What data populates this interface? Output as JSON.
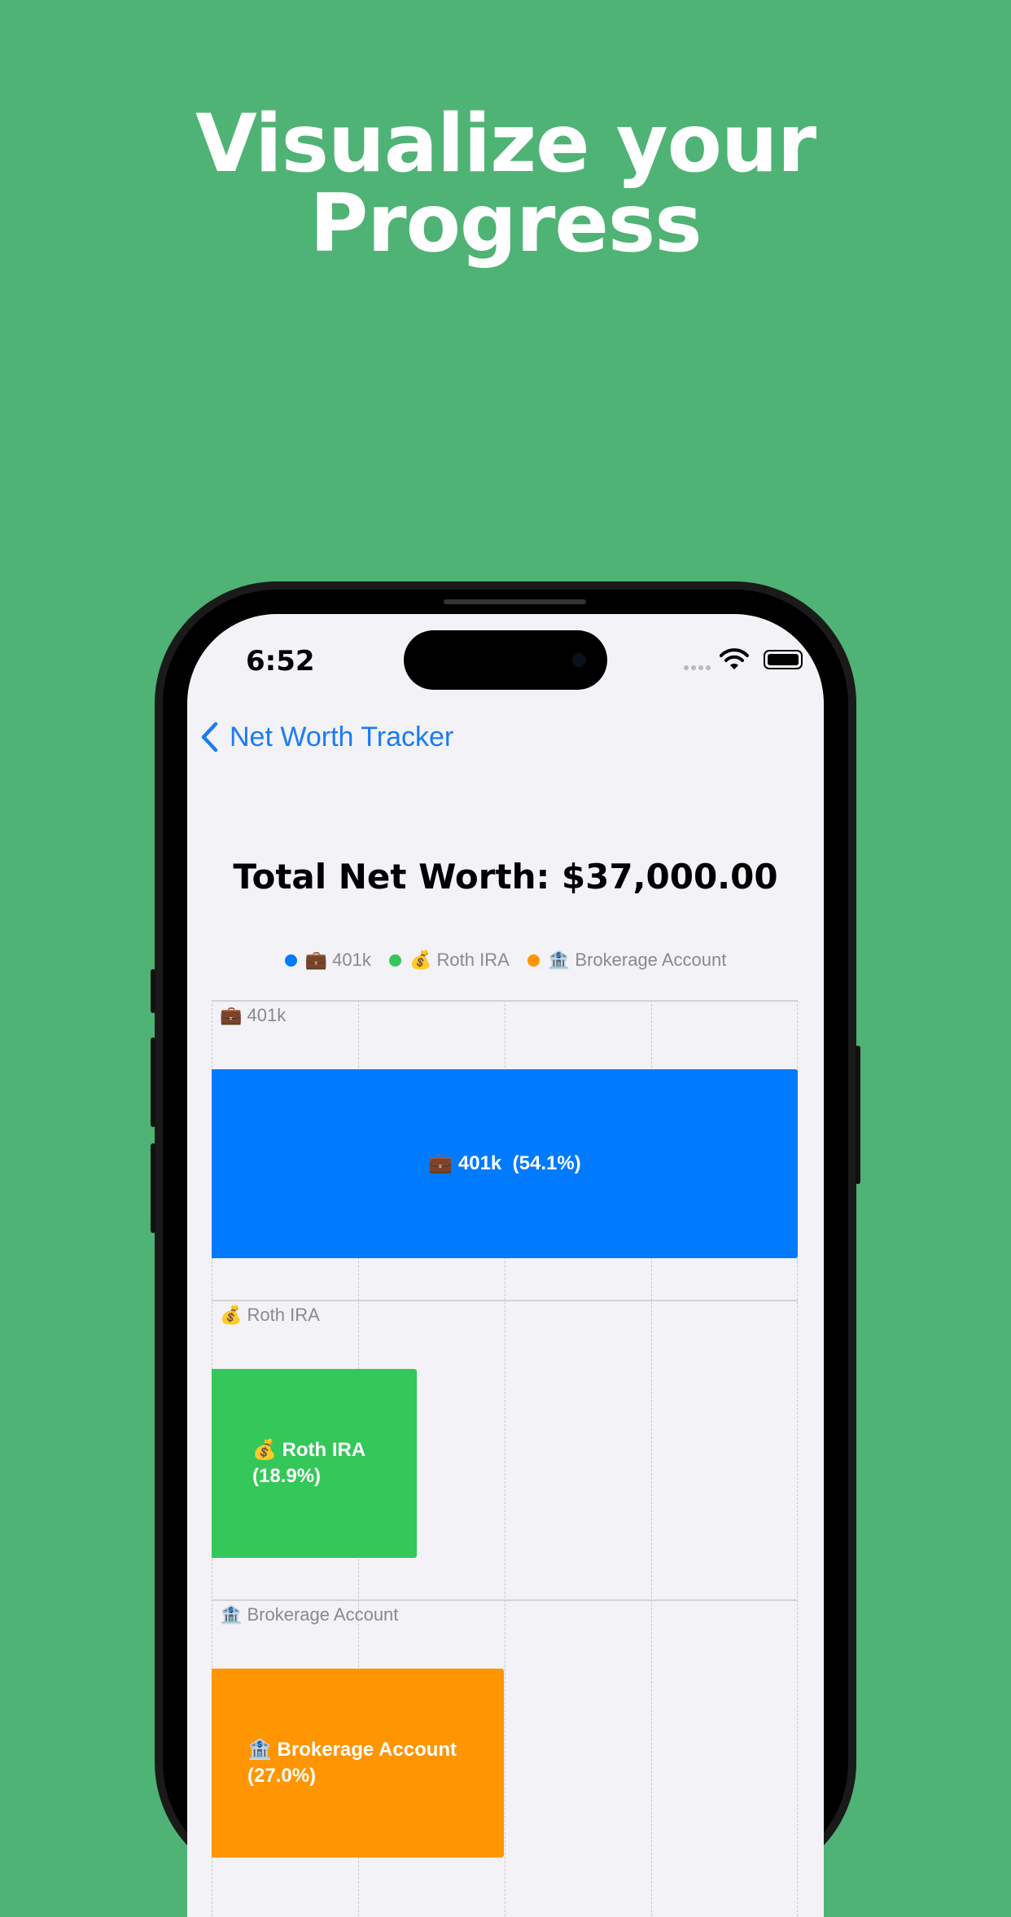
{
  "headline": {
    "line1": "Visualize your",
    "line2": "Progress"
  },
  "status_bar": {
    "time": "6:52"
  },
  "nav": {
    "back_label": "Net Worth Tracker"
  },
  "summary": {
    "total_text": "Total Net Worth: $37,000.00"
  },
  "colors": {
    "background": "#4FB375",
    "link": "#1A7CF5",
    "series_401k": "#007AFF",
    "series_roth": "#34C759",
    "series_brokerage": "#FF9500"
  },
  "chart_data": {
    "type": "bar",
    "orientation": "horizontal",
    "categories": [
      "💼 401k",
      "💰 Roth IRA",
      "🏦 Brokerage Account"
    ],
    "values": [
      54.1,
      18.9,
      27.0
    ],
    "legend": [
      "💼 401k",
      "💰 Roth IRA",
      "🏦 Brokerage Account"
    ],
    "legend_position": "top",
    "xlim": [
      0,
      54.1
    ],
    "bars": [
      {
        "label": "💼 401k",
        "pct_label": "(54.1%)",
        "value": 54.1,
        "color": "#007AFF"
      },
      {
        "label": "💰 Roth IRA",
        "pct_label": "(18.9%)",
        "value": 18.9,
        "color": "#34C759"
      },
      {
        "label": "🏦 Brokerage Account",
        "pct_label": "(27.0%)",
        "value": 27.0,
        "color": "#FF9500"
      }
    ],
    "grid": true
  }
}
